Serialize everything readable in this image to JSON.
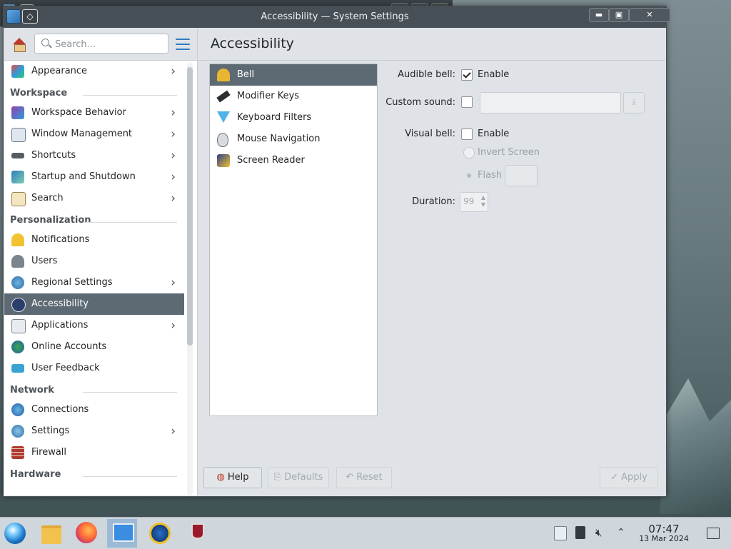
{
  "window": {
    "title": "Accessibility — System Settings"
  },
  "sidebar": {
    "search_placeholder": "Search...",
    "items": [
      {
        "label": "Appearance",
        "chevron": true
      },
      {
        "section": "Workspace"
      },
      {
        "label": "Workspace Behavior",
        "chevron": true
      },
      {
        "label": "Window Management",
        "chevron": true
      },
      {
        "label": "Shortcuts",
        "chevron": true
      },
      {
        "label": "Startup and Shutdown",
        "chevron": true
      },
      {
        "label": "Search",
        "chevron": true
      },
      {
        "section": "Personalization"
      },
      {
        "label": "Notifications",
        "chevron": false
      },
      {
        "label": "Users",
        "chevron": false
      },
      {
        "label": "Regional Settings",
        "chevron": true
      },
      {
        "label": "Accessibility",
        "chevron": false,
        "selected": true
      },
      {
        "label": "Applications",
        "chevron": true
      },
      {
        "label": "Online Accounts",
        "chevron": false
      },
      {
        "label": "User Feedback",
        "chevron": false
      },
      {
        "section": "Network"
      },
      {
        "label": "Connections",
        "chevron": false
      },
      {
        "label": "Settings",
        "chevron": true
      },
      {
        "label": "Firewall",
        "chevron": false
      },
      {
        "section": "Hardware"
      }
    ],
    "chevron_glyph": "›"
  },
  "content": {
    "title": "Accessibility",
    "subitems": [
      "Bell",
      "Modifier Keys",
      "Keyboard Filters",
      "Mouse Navigation",
      "Screen Reader"
    ],
    "selected_subitem": "Bell",
    "bell": {
      "audible_bell_label": "Audible bell:",
      "audible_enable_label": "Enable",
      "audible_enabled": true,
      "custom_sound_label": "Custom sound:",
      "custom_sound_value": "",
      "visual_bell_label": "Visual bell:",
      "visual_enable_label": "Enable",
      "visual_enabled": false,
      "invert_screen_label": "Invert Screen",
      "flash_label": "Flash",
      "duration_label": "Duration:",
      "duration_value": "99"
    }
  },
  "buttons": {
    "help": "Help",
    "defaults": "Defaults",
    "reset": "Reset",
    "apply": "Apply"
  },
  "taskbar": {
    "time": "07:47",
    "date": "13 Mar 2024"
  },
  "colors": {
    "selection": "#5e6a73",
    "accent": "#2f7cc4",
    "titlebar": "#475057"
  }
}
